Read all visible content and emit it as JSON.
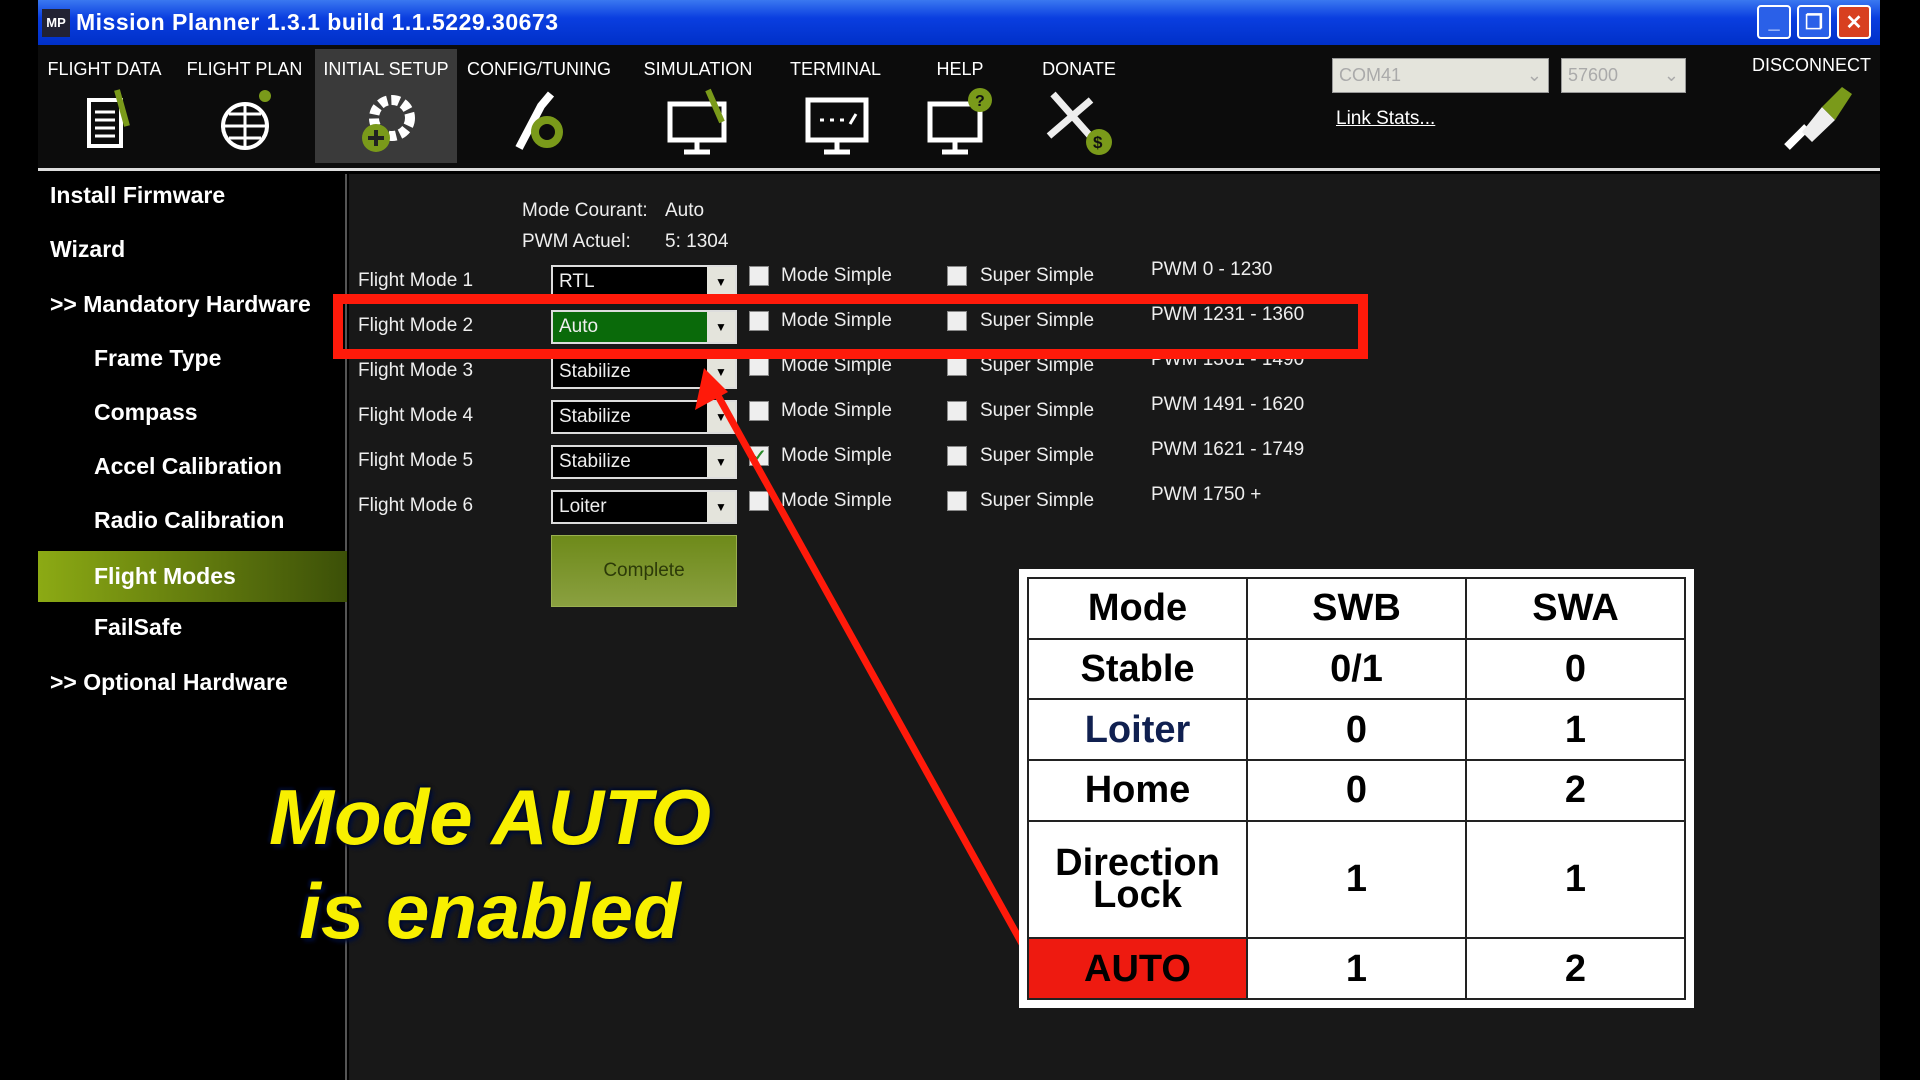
{
  "window": {
    "title": "Mission Planner 1.3.1 build 1.1.5229.30673",
    "logo": "MP",
    "controls": [
      "minimize",
      "restore",
      "close"
    ]
  },
  "toolbar": {
    "items": [
      {
        "label": "FLIGHT DATA",
        "icon": "flight-data-icon"
      },
      {
        "label": "FLIGHT PLAN",
        "icon": "globe-icon"
      },
      {
        "label": "INITIAL SETUP",
        "icon": "gear-plus-icon",
        "active": true
      },
      {
        "label": "CONFIG/TUNING",
        "icon": "wrench-gear-icon"
      },
      {
        "label": "SIMULATION",
        "icon": "monitor-plane-icon"
      },
      {
        "label": "TERMINAL",
        "icon": "terminal-icon"
      },
      {
        "label": "HELP",
        "icon": "help-monitor-icon"
      },
      {
        "label": "DONATE",
        "icon": "plane-dollar-icon"
      }
    ],
    "port": "COM41",
    "baud": "57600",
    "link_stats": "Link Stats...",
    "disconnect": "DISCONNECT"
  },
  "sidebar": {
    "items": [
      {
        "label": "Install Firmware"
      },
      {
        "label": "Wizard"
      },
      {
        "label": ">> Mandatory Hardware"
      },
      {
        "label": "Frame Type"
      },
      {
        "label": "Compass"
      },
      {
        "label": "Accel Calibration"
      },
      {
        "label": "Radio Calibration"
      },
      {
        "label": "Flight Modes",
        "active": true
      },
      {
        "label": "FailSafe"
      },
      {
        "label": ">> Optional Hardware"
      }
    ]
  },
  "status": {
    "mode_label": "Mode Courant:",
    "mode_value": "Auto",
    "pwm_label": "PWM Actuel:",
    "pwm_value": "5: 1304"
  },
  "modes": [
    {
      "label": "Flight Mode 1",
      "value": "RTL",
      "simple": false,
      "super": false,
      "pwm": "PWM 0 - 1230"
    },
    {
      "label": "Flight Mode 2",
      "value": "Auto",
      "simple": false,
      "super": false,
      "pwm": "PWM 1231 - 1360",
      "active": true
    },
    {
      "label": "Flight Mode 3",
      "value": "Stabilize",
      "simple": false,
      "super": false,
      "pwm": "PWM 1361 - 1490"
    },
    {
      "label": "Flight Mode 4",
      "value": "Stabilize",
      "simple": false,
      "super": false,
      "pwm": "PWM 1491 - 1620"
    },
    {
      "label": "Flight Mode 5",
      "value": "Stabilize",
      "simple": true,
      "super": false,
      "pwm": "PWM 1621 - 1749"
    },
    {
      "label": "Flight Mode 6",
      "value": "Loiter",
      "simple": false,
      "super": false,
      "pwm": "PWM 1750 +"
    }
  ],
  "labels": {
    "simple": "Mode Simple",
    "super": "Super Simple",
    "complete": "Complete"
  },
  "caption": {
    "line1": "Mode AUTO",
    "line2": "is enabled"
  },
  "switch_table": {
    "headers": [
      "Mode",
      "SWB",
      "SWA"
    ],
    "rows": [
      [
        "Stable",
        "0/1",
        "0"
      ],
      [
        "Loiter",
        "0",
        "1"
      ],
      [
        "Home",
        "0",
        "2"
      ],
      [
        "Direction Lock",
        "1",
        "1"
      ],
      [
        "AUTO",
        "1",
        "2"
      ]
    ]
  },
  "colors": {
    "highlight": "#ff1a0a",
    "caption": "#f8f000",
    "active_mode": "#0a6a0a",
    "accent": "#8caa14"
  }
}
